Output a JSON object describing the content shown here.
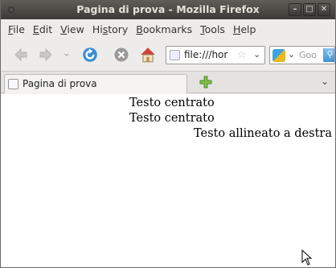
{
  "window": {
    "title": "Pagina di prova - Mozilla Firefox"
  },
  "menu": {
    "items": [
      "File",
      "Edit",
      "View",
      "History",
      "Bookmarks",
      "Tools",
      "Help"
    ],
    "accel": [
      "F",
      "E",
      "V",
      "s",
      "B",
      "T",
      "H"
    ]
  },
  "navbar": {
    "url": "file:///hor",
    "search_placeholder": "Goo"
  },
  "tabs": [
    {
      "label": "Pagina di prova"
    }
  ],
  "page": {
    "line1": "Testo centrato",
    "line2": "Testo centrato",
    "line3": "Testo allineato a destra"
  },
  "icons": {
    "back": "back-arrow-icon",
    "forward": "forward-arrow-icon",
    "reload": "reload-icon",
    "stop": "stop-icon",
    "home": "home-icon",
    "bookmark": "star-icon",
    "newtab": "plus-icon",
    "search": "magnifier-icon"
  },
  "colors": {
    "titlebar": "#3d3b37",
    "reload": "#3b8ed4",
    "stop": "#9a9a9a",
    "home_roof": "#d0453a",
    "newtab": "#7cc04a"
  }
}
